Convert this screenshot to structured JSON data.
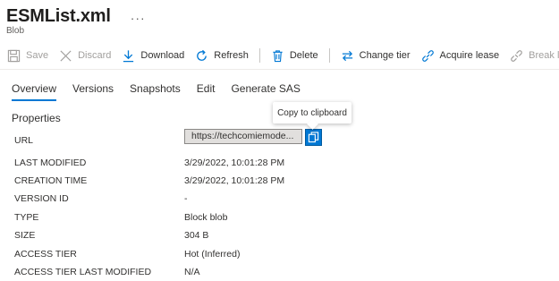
{
  "header": {
    "title": "ESMList.xml",
    "more_label": "···",
    "subtitle": "Blob"
  },
  "toolbar": {
    "save": "Save",
    "discard": "Discard",
    "download": "Download",
    "refresh": "Refresh",
    "delete": "Delete",
    "change_tier": "Change tier",
    "acquire_lease": "Acquire lease",
    "break_lease": "Break lease"
  },
  "tabs": [
    "Overview",
    "Versions",
    "Snapshots",
    "Edit",
    "Generate SAS"
  ],
  "active_tab": "Overview",
  "section_title": "Properties",
  "properties": {
    "url_label": "URL",
    "url_value": "https://techcomiemode...",
    "copy_tooltip": "Copy to clipboard",
    "last_modified_label": "LAST MODIFIED",
    "last_modified_value": "3/29/2022, 10:01:28 PM",
    "creation_time_label": "CREATION TIME",
    "creation_time_value": "3/29/2022, 10:01:28 PM",
    "version_id_label": "VERSION ID",
    "version_id_value": "-",
    "type_label": "TYPE",
    "type_value": "Block blob",
    "size_label": "SIZE",
    "size_value": "304 B",
    "access_tier_label": "ACCESS TIER",
    "access_tier_value": "Hot (Inferred)",
    "access_tier_modified_label": "ACCESS TIER LAST MODIFIED",
    "access_tier_modified_value": "N/A"
  },
  "colors": {
    "accent": "#0078d4",
    "disabled_text": "#a19f9d"
  },
  "icons": [
    "save-icon",
    "discard-icon",
    "download-icon",
    "refresh-icon",
    "delete-icon",
    "change-tier-icon",
    "acquire-lease-icon",
    "break-lease-icon",
    "copy-icon"
  ]
}
